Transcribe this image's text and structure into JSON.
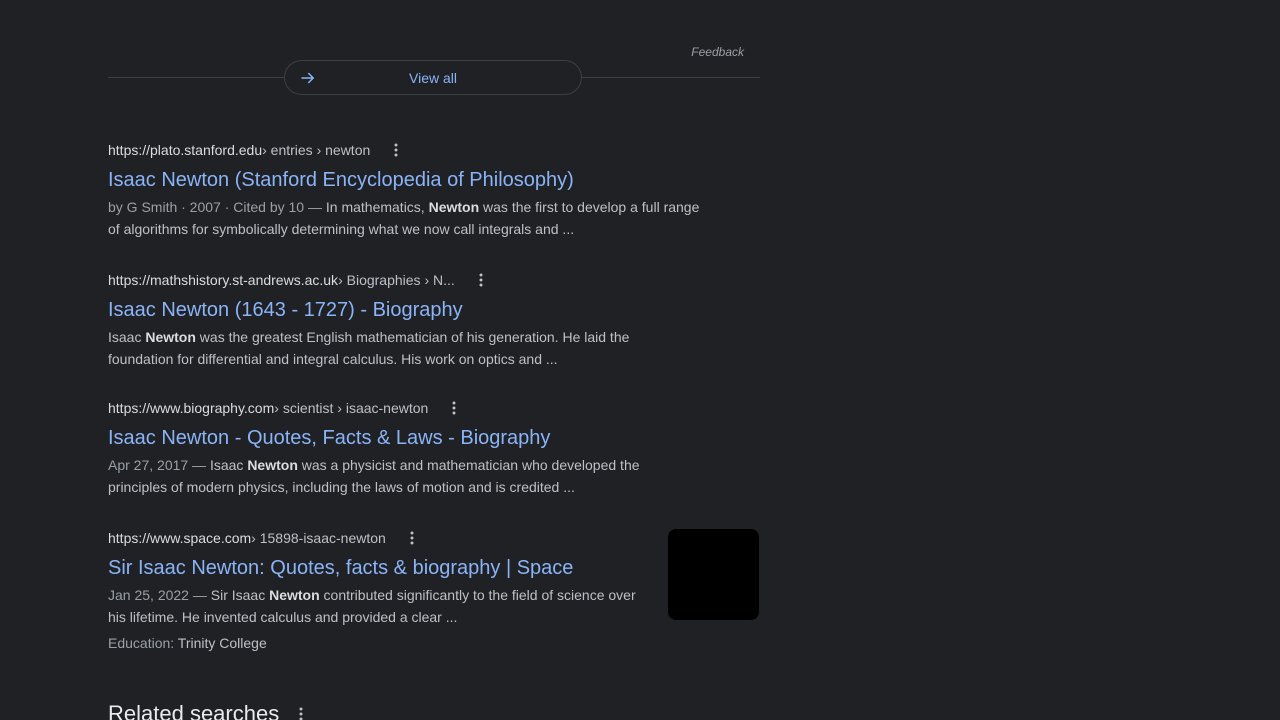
{
  "feedback_label": "Feedback",
  "view_all": {
    "label": "View all",
    "icon": "arrow-right-icon"
  },
  "results": [
    {
      "domain": "https://plato.stanford.edu",
      "path": " › entries › newton",
      "title": "Isaac Newton (Stanford Encyclopedia of Philosophy)",
      "snippet_prefix": "by G Smith · 2007 · Cited by 10 — ",
      "snippet_before": "In mathematics, ",
      "snippet_bold": "Newton",
      "snippet_after": " was the first to develop a full range of algorithms for symbolically determining what we now call integrals and ..."
    },
    {
      "domain": "https://mathshistory.st-andrews.ac.uk",
      "path": " › Biographies › N...",
      "title": "Isaac Newton (1643 - 1727) - Biography",
      "snippet_prefix": "",
      "snippet_before": "Isaac ",
      "snippet_bold": "Newton",
      "snippet_after": " was the greatest English mathematician of his generation. He laid the foundation for differential and integral calculus. His work on optics and ..."
    },
    {
      "domain": "https://www.biography.com",
      "path": " › scientist › isaac-newton",
      "title": "Isaac Newton - Quotes, Facts & Laws - Biography",
      "snippet_prefix": "Apr 27, 2017 — ",
      "snippet_before": "Isaac ",
      "snippet_bold": "Newton",
      "snippet_after": " was a physicist and mathematician who developed the principles of modern physics, including the laws of motion and is credited ..."
    },
    {
      "domain": "https://www.space.com",
      "path": " › 15898-isaac-newton",
      "title": "Sir Isaac Newton: Quotes, facts & biography | Space",
      "snippet_prefix": "Jan 25, 2022 — ",
      "snippet_before": "Sir Isaac ",
      "snippet_bold": "Newton",
      "snippet_after": " contributed significantly to the field of science over his lifetime. He invented calculus and provided a clear ...",
      "extra_label": "Education: ",
      "extra_value": "Trinity College"
    }
  ],
  "related_searches": {
    "heading": "Related searches"
  }
}
